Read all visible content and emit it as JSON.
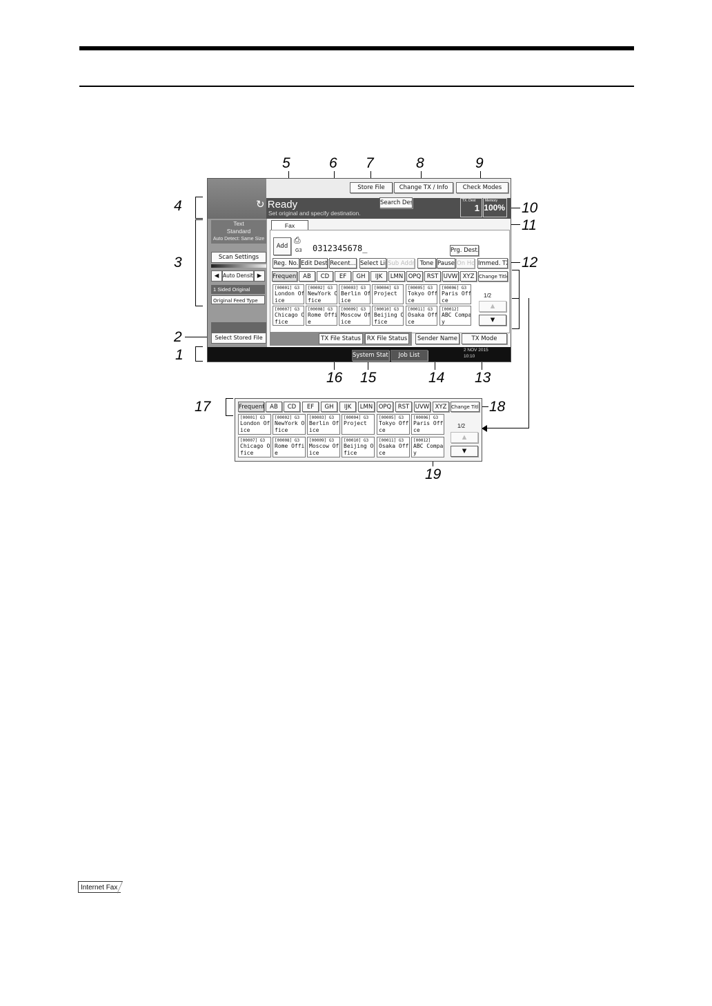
{
  "screen": {
    "status": "Ready",
    "message": "Set original and specify destination.",
    "top_buttons": {
      "store_file": "Store File",
      "change_tx_info": "Change TX / Info",
      "check_modes": "Check Modes"
    },
    "search_dest": "Search Dest.",
    "tx_dest_label": "TX. Dest",
    "tx_dest_value": "1",
    "memory_label": "Memory",
    "memory_value": "100%",
    "fax_tab": "Fax",
    "scan": {
      "line1": "Text",
      "line2": "Standard",
      "line3": "Auto Detect: Same Size",
      "settings": "Scan Settings"
    },
    "auto_density": "Auto Density",
    "sided": "1 Sided Original",
    "feed_type": "Original Feed Type",
    "select_stored_file": "Select Stored File",
    "add": "Add",
    "line_type": "G3",
    "number": "0312345678_",
    "prg_dest": "Prg. Dest.",
    "func_buttons": [
      "Reg. No.",
      "Edit Dest.",
      "Recent...",
      "Select Line",
      "Sub Address",
      "Tone",
      "Pause",
      "On Hook",
      "Immed. TX"
    ],
    "index_tabs": [
      "Frequent",
      "AB",
      "CD",
      "EF",
      "GH",
      "IJK",
      "LMN",
      "OPQ",
      "RST",
      "UVW",
      "XYZ"
    ],
    "change_title": "Change Title",
    "page": "1/2",
    "tx_file_status": "TX File Status",
    "rx_file_status": "RX File Status",
    "sender_name": "Sender Name",
    "tx_mode": "TX Mode",
    "system_status": "System Status",
    "job_list": "Job List",
    "date": "2 NOV  2015",
    "time": "10:10",
    "entries": [
      {
        "id": "[00001] G3",
        "l1": "London Off",
        "l2": "ice"
      },
      {
        "id": "[00002] G3",
        "l1": "NewYork Of",
        "l2": "fice"
      },
      {
        "id": "[00003] G3",
        "l1": "Berlin Off",
        "l2": "ice"
      },
      {
        "id": "[00004] G3",
        "l1": "Project",
        "l2": ""
      },
      {
        "id": "[00005] G3",
        "l1": "Tokyo Offi",
        "l2": "ce"
      },
      {
        "id": "[00006] G3",
        "l1": "Paris Offi",
        "l2": "ce"
      },
      {
        "id": "[00007] G3",
        "l1": "Chicago Of",
        "l2": "fice"
      },
      {
        "id": "[00008] G3",
        "l1": "Rome Offic",
        "l2": "e"
      },
      {
        "id": "[00009] G3",
        "l1": "Moscow Off",
        "l2": "ice"
      },
      {
        "id": "[00010] G3",
        "l1": "Beijing Of",
        "l2": "fice"
      },
      {
        "id": "[00011] G3",
        "l1": "Osaka Offi",
        "l2": "ce"
      },
      {
        "id": "[00012]",
        "l1": "ABC Compan",
        "l2": "y"
      }
    ]
  },
  "callouts": [
    "1",
    "2",
    "3",
    "4",
    "5",
    "6",
    "7",
    "8",
    "9",
    "10",
    "11",
    "12",
    "13",
    "14",
    "15",
    "16",
    "17",
    "18",
    "19"
  ],
  "footer_tab": "Internet Fax"
}
